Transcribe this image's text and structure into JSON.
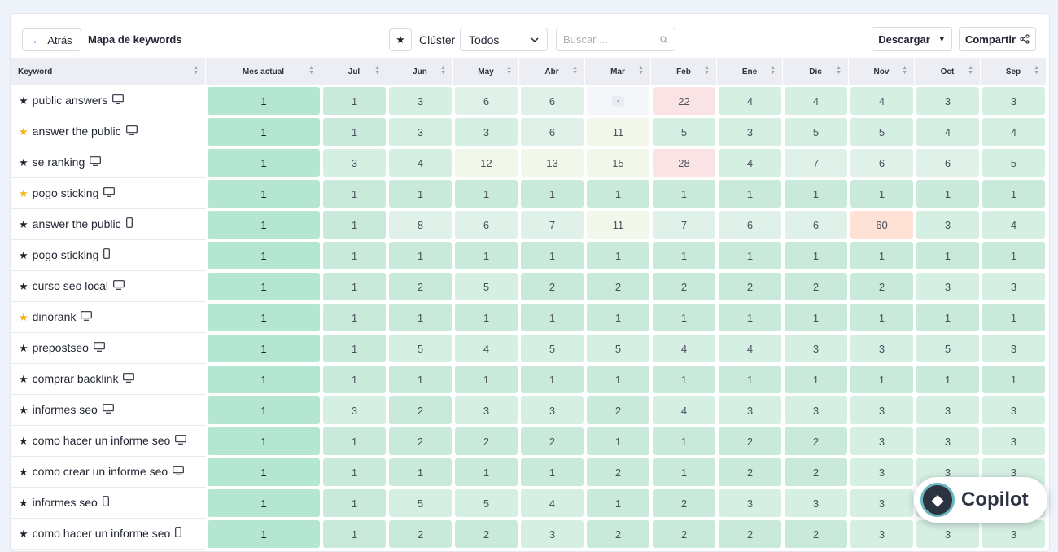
{
  "toolbar": {
    "back_label": "Atrás",
    "title": "Mapa de keywords",
    "cluster_label": "Clúster",
    "cluster_value": "Todos",
    "search_placeholder": "Buscar ...",
    "download_label": "Descargar",
    "share_label": "Compartir"
  },
  "table": {
    "headers": [
      "Keyword",
      "Mes actual",
      "Jul",
      "Jun",
      "May",
      "Abr",
      "Mar",
      "Feb",
      "Ene",
      "Dic",
      "Nov",
      "Oct",
      "Sep"
    ],
    "rows": [
      {
        "keyword": "public answers",
        "star": "black",
        "device": "desktop",
        "values": [
          "1",
          "1",
          "3",
          "6",
          "6",
          "-",
          "22",
          "4",
          "4",
          "4",
          "3",
          "3"
        ]
      },
      {
        "keyword": "answer the public",
        "star": "gold",
        "device": "desktop",
        "values": [
          "1",
          "1",
          "3",
          "3",
          "6",
          "11",
          "5",
          "3",
          "5",
          "5",
          "4",
          "4"
        ]
      },
      {
        "keyword": "se ranking",
        "star": "black",
        "device": "desktop",
        "values": [
          "1",
          "3",
          "4",
          "12",
          "13",
          "15",
          "28",
          "4",
          "7",
          "6",
          "6",
          "5"
        ]
      },
      {
        "keyword": "pogo sticking",
        "star": "gold",
        "device": "desktop",
        "values": [
          "1",
          "1",
          "1",
          "1",
          "1",
          "1",
          "1",
          "1",
          "1",
          "1",
          "1",
          "1"
        ]
      },
      {
        "keyword": "answer the public",
        "star": "black",
        "device": "mobile",
        "values": [
          "1",
          "1",
          "8",
          "6",
          "7",
          "11",
          "7",
          "6",
          "6",
          "60",
          "3",
          "4"
        ]
      },
      {
        "keyword": "pogo sticking",
        "star": "black",
        "device": "mobile",
        "values": [
          "1",
          "1",
          "1",
          "1",
          "1",
          "1",
          "1",
          "1",
          "1",
          "1",
          "1",
          "1"
        ]
      },
      {
        "keyword": "curso seo local",
        "star": "black",
        "device": "desktop",
        "values": [
          "1",
          "1",
          "2",
          "5",
          "2",
          "2",
          "2",
          "2",
          "2",
          "2",
          "3",
          "3"
        ]
      },
      {
        "keyword": "dinorank",
        "star": "gold",
        "device": "desktop",
        "values": [
          "1",
          "1",
          "1",
          "1",
          "1",
          "1",
          "1",
          "1",
          "1",
          "1",
          "1",
          "1"
        ]
      },
      {
        "keyword": "prepostseo",
        "star": "black",
        "device": "desktop",
        "values": [
          "1",
          "1",
          "5",
          "4",
          "5",
          "5",
          "4",
          "4",
          "3",
          "3",
          "5",
          "3"
        ]
      },
      {
        "keyword": "comprar backlink",
        "star": "black",
        "device": "desktop",
        "values": [
          "1",
          "1",
          "1",
          "1",
          "1",
          "1",
          "1",
          "1",
          "1",
          "1",
          "1",
          "1"
        ]
      },
      {
        "keyword": "informes seo",
        "star": "black",
        "device": "desktop",
        "values": [
          "1",
          "3",
          "2",
          "3",
          "3",
          "2",
          "4",
          "3",
          "3",
          "3",
          "3",
          "3"
        ]
      },
      {
        "keyword": "como hacer un informe seo",
        "star": "black",
        "device": "desktop",
        "values": [
          "1",
          "1",
          "2",
          "2",
          "2",
          "1",
          "1",
          "2",
          "2",
          "3",
          "3",
          "3"
        ]
      },
      {
        "keyword": "como crear un informe seo",
        "star": "black",
        "device": "desktop",
        "values": [
          "1",
          "1",
          "1",
          "1",
          "1",
          "2",
          "1",
          "2",
          "2",
          "3",
          "3",
          "3"
        ]
      },
      {
        "keyword": "informes seo",
        "star": "black",
        "device": "mobile",
        "values": [
          "1",
          "1",
          "5",
          "5",
          "4",
          "1",
          "2",
          "3",
          "3",
          "3",
          "3",
          "3"
        ]
      },
      {
        "keyword": "como hacer un informe seo",
        "star": "black",
        "device": "mobile",
        "values": [
          "1",
          "1",
          "2",
          "2",
          "3",
          "2",
          "2",
          "2",
          "2",
          "3",
          "3",
          "3"
        ]
      }
    ]
  },
  "colors": {
    "current_month": "#b4e6d2",
    "rank_good": "#c9eadb",
    "rank_mid": "#dff1e8",
    "rank_neutral": "#f2f7ec",
    "rank_bad": "#f9e3e4",
    "rank_worst": "#fde2d5"
  },
  "copilot": {
    "label": "Copilot"
  }
}
